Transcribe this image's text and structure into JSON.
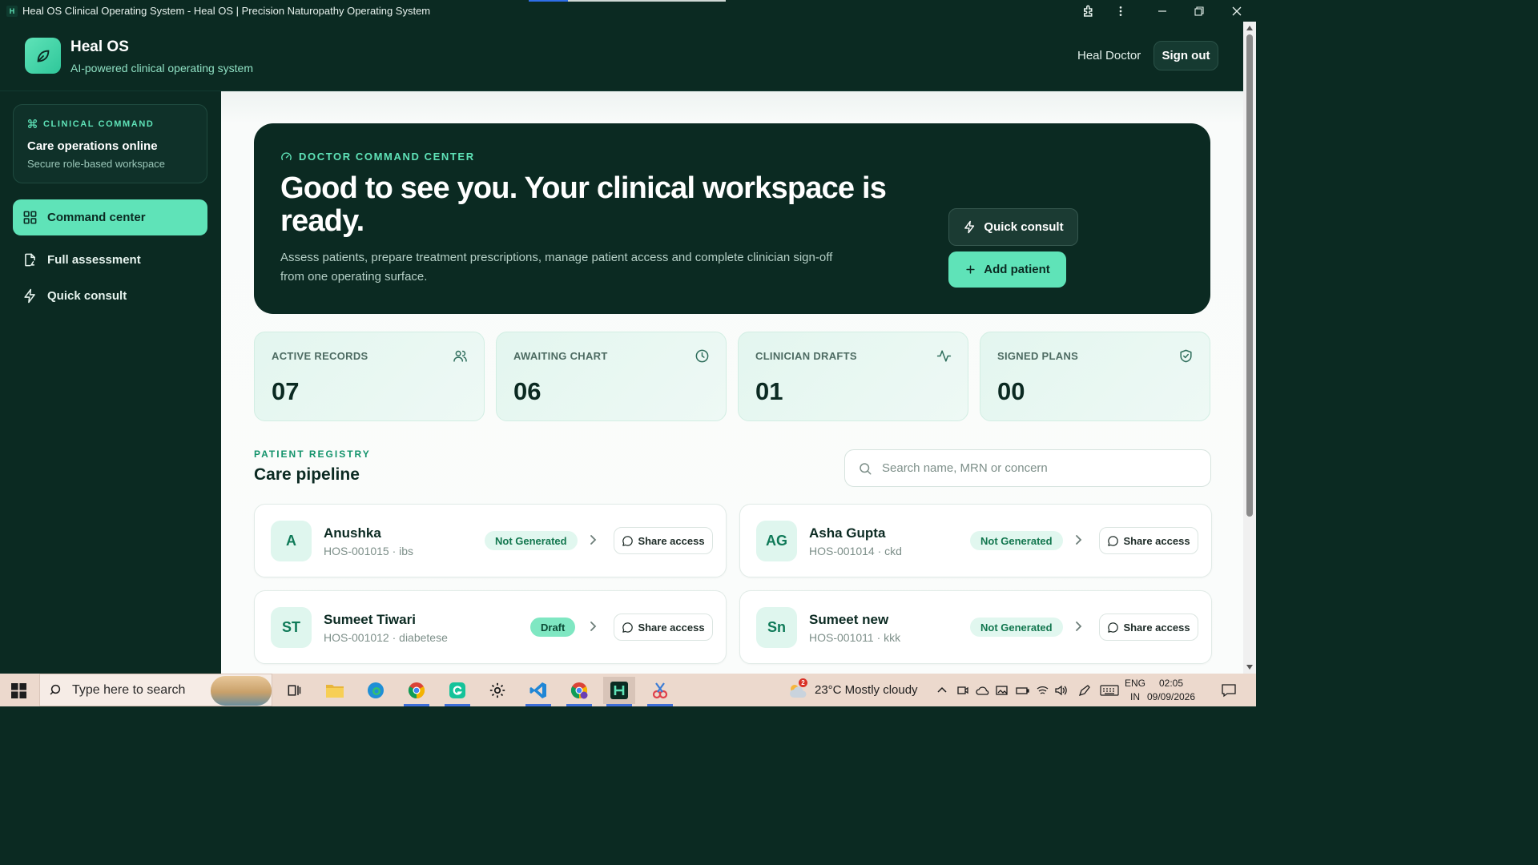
{
  "window": {
    "app_icon_letter": "H",
    "title": "Heal OS Clinical Operating System - Heal OS | Precision Naturopathy Operating System",
    "page_load_progress": 0.2
  },
  "header": {
    "brand_name": "Heal OS",
    "brand_subtitle": "AI-powered clinical operating system",
    "user_name": "Heal Doctor",
    "sign_out_label": "Sign out"
  },
  "sidebar": {
    "status_card": {
      "tag": "CLINICAL COMMAND",
      "title": "Care operations online",
      "subtitle": "Secure role-based workspace"
    },
    "nav": [
      {
        "label": "Command center",
        "icon": "grid-icon",
        "active": true
      },
      {
        "label": "Full assessment",
        "icon": "document-icon",
        "active": false
      },
      {
        "label": "Quick consult",
        "icon": "bolt-icon",
        "active": false
      }
    ]
  },
  "hero": {
    "tag": "DOCTOR COMMAND CENTER",
    "title": "Good to see you. Your clinical workspace is ready.",
    "description": "Assess patients, prepare treatment prescriptions, manage patient access and complete clinician sign-off from one operating surface.",
    "quick_consult_label": "Quick consult",
    "add_patient_label": "Add patient"
  },
  "stats": [
    {
      "label": "ACTIVE RECORDS",
      "value": "07",
      "icon": "users-icon"
    },
    {
      "label": "AWAITING CHART",
      "value": "06",
      "icon": "clock-icon"
    },
    {
      "label": "CLINICIAN DRAFTS",
      "value": "01",
      "icon": "activity-icon"
    },
    {
      "label": "SIGNED PLANS",
      "value": "00",
      "icon": "shield-check-icon"
    }
  ],
  "registry": {
    "tag": "PATIENT REGISTRY",
    "title": "Care pipeline",
    "search_placeholder": "Search name, MRN or concern",
    "search_value": "",
    "patients": [
      {
        "initials": "A",
        "name": "Anushka",
        "meta": "HOS-001015 · ibs",
        "status": "Not Generated",
        "share_label": "Share access"
      },
      {
        "initials": "AG",
        "name": "Asha Gupta",
        "meta": "HOS-001014 · ckd",
        "status": "Not Generated",
        "share_label": "Share access"
      },
      {
        "initials": "ST",
        "name": "Sumeet Tiwari",
        "meta": "HOS-001012 · diabetese",
        "status": "Draft",
        "share_label": "Share access"
      },
      {
        "initials": "Sn",
        "name": "Sumeet new",
        "meta": "HOS-001011 · kkk",
        "status": "Not Generated",
        "share_label": "Share access"
      }
    ]
  },
  "taskbar": {
    "search_placeholder": "Type here to search",
    "weather_badge": "2",
    "weather_text": "23°C  Mostly cloudy",
    "lang_line1": "ENG",
    "lang_line2": "IN",
    "time": "02:05",
    "date": "09/09/2026"
  },
  "colors": {
    "brand_dark": "#0b2a22",
    "accent_mint": "#5fe3b8",
    "accent_green": "#13936b",
    "draft_badge": "#7fe7c2"
  }
}
